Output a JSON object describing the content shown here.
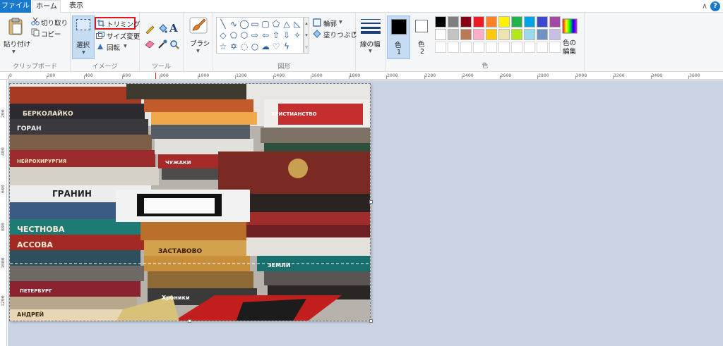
{
  "tabs": {
    "file": "ファイル",
    "home": "ホーム",
    "view": "表示"
  },
  "clipboard": {
    "paste": "貼り付け",
    "cut": "切り取り",
    "copy": "コピー",
    "group": "クリップボード"
  },
  "image": {
    "select": "選択",
    "crop": "トリミング",
    "resize": "サイズ変更",
    "rotate": "回転",
    "group": "イメージ"
  },
  "tools": {
    "group": "ツール"
  },
  "brush": {
    "label": "ブラシ"
  },
  "shapes": {
    "outline": "輪郭",
    "fill": "塗りつぶし",
    "group": "図形"
  },
  "size": {
    "label": "線の幅"
  },
  "colors": {
    "color1_label": "色",
    "color1_num": "1",
    "color2_label": "色",
    "color2_num": "2",
    "edit": "色の編集",
    "group": "色",
    "palette_row1": [
      "#000000",
      "#7f7f7f",
      "#880015",
      "#ed1c24",
      "#ff7f27",
      "#fff200",
      "#22b14c",
      "#00a2e8",
      "#3f48cc",
      "#a349a4"
    ],
    "palette_row2": [
      "#ffffff",
      "#c3c3c3",
      "#b97a57",
      "#ffaec9",
      "#ffc90e",
      "#efe4b0",
      "#b5e61d",
      "#99d9ea",
      "#7092be",
      "#c8bfe7"
    ]
  },
  "ruler_h": [
    "0",
    "200",
    "400",
    "600",
    "800",
    "1000",
    "1200",
    "1400",
    "1600",
    "1800",
    "2000",
    "2200",
    "2400",
    "2600",
    "2800",
    "3000",
    "3200",
    "3400",
    "3600"
  ],
  "ruler_v": [
    "200",
    "400",
    "600",
    "800",
    "1000",
    "1200"
  ],
  "book_titles": [
    "БЕРКОЛАЙКО",
    "ГОРАН",
    "НЕЙРОХИРУРГИЯ",
    "ЧУЖАКИ",
    "ГРАНИН",
    "ЧЕСТНОВА",
    "АССОВА",
    "ПЕТЕРБУРГ",
    "ЗАСТАВОВО",
    "Хроники",
    "ЗЕМЛИ",
    "ХРИСТИАНСТВО",
    "АНДРЕЙ"
  ]
}
